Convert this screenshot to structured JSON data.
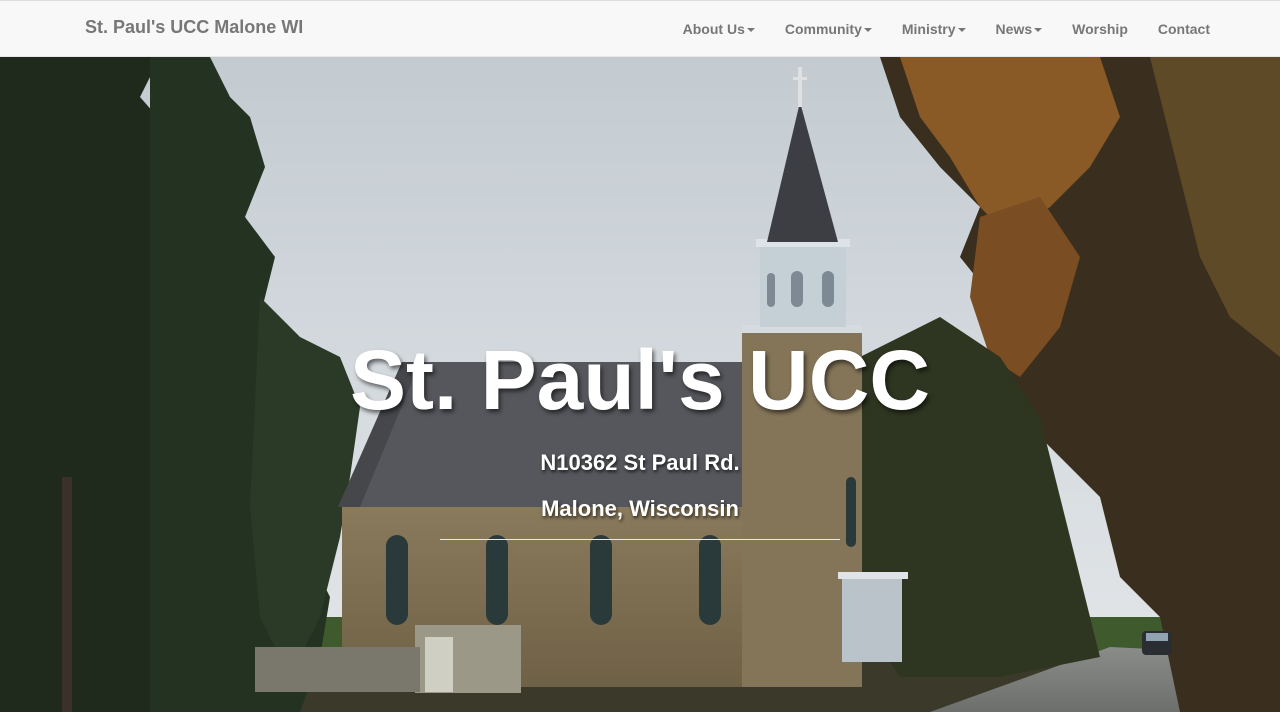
{
  "navbar": {
    "brand": "St. Paul's UCC Malone WI",
    "items": [
      {
        "label": "About Us",
        "dropdown": true
      },
      {
        "label": "Community",
        "dropdown": true
      },
      {
        "label": "Ministry",
        "dropdown": true
      },
      {
        "label": "News",
        "dropdown": true
      },
      {
        "label": "Worship",
        "dropdown": false
      },
      {
        "label": "Contact",
        "dropdown": false
      }
    ]
  },
  "hero": {
    "title": "St. Paul's UCC",
    "address_line1": "N10362 St Paul Rd.",
    "address_line2": "Malone, Wisconsin",
    "image_subject": "church-photo"
  },
  "colors": {
    "navbar_bg": "#f8f8f8",
    "nav_text": "#777777",
    "hero_text": "#ffffff"
  }
}
